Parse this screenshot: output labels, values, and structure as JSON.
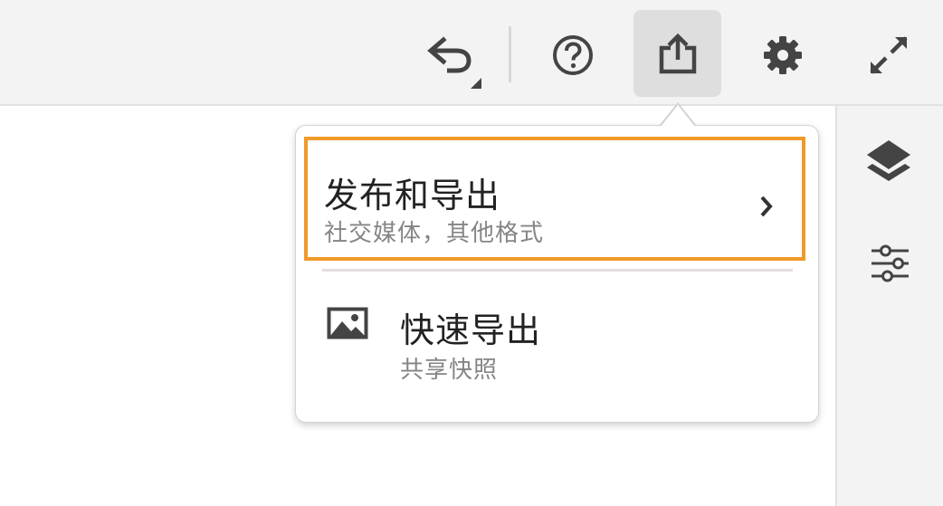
{
  "toolbar": {
    "icons": {
      "undo": "undo-icon",
      "help": "help-icon",
      "share": "share-icon",
      "settings": "gear-icon",
      "fullscreen": "fullscreen-icon"
    }
  },
  "side_panel": {
    "icons": {
      "layers": "layers-icon",
      "adjust": "sliders-icon"
    }
  },
  "share_menu": {
    "items": [
      {
        "title": "发布和导出",
        "subtitle": "社交媒体，其他格式",
        "icon": "chevron-right-icon",
        "highlighted": true
      },
      {
        "title": "快速导出",
        "subtitle": "共享快照",
        "icon": "image-icon",
        "highlighted": false
      }
    ]
  },
  "colors": {
    "highlight_border": "#f09a2a",
    "toolbar_bg": "#f3f3f3",
    "active_button_bg": "#dedede",
    "icon_color": "#444444",
    "subtitle_color": "#858585"
  }
}
